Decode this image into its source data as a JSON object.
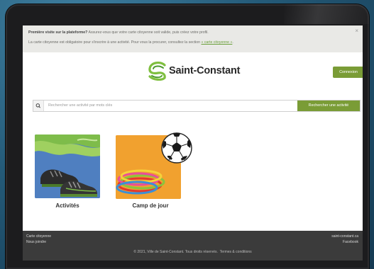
{
  "notice": {
    "line1_bold": "Première visite sur la plateforme?",
    "line1_text": " Assurez-vous que votre carte citoyenne soit valide, puis créez votre profil.",
    "line2_text": "La carte citoyenne est obligatoire pour s'inscrire à une activité. Pour vous la procurer, consultez la section ",
    "line2_link": "« carte citoyenne »",
    "line2_end": ".",
    "close": "×"
  },
  "header": {
    "logo_text": "Saint-Constant",
    "login_button": "Connexion"
  },
  "search": {
    "placeholder": "Rechercher une activité par mots clés",
    "button": "Rechercher une activité"
  },
  "cards": [
    {
      "label": "Activités"
    },
    {
      "label": "Camp de jour"
    }
  ],
  "footer": {
    "left_links": [
      "Carte citoyenne",
      "Nous joindre"
    ],
    "right_links": [
      "saint-constant.ca",
      "Facebook"
    ],
    "copyright": "© 2021, Ville de Saint-Constant. Tous droits réservés.",
    "terms": "Termes & conditions"
  },
  "colors": {
    "brand_green": "#7a9c36",
    "footer_bg": "#3b3b3b",
    "notice_bg": "#e9e9e6"
  }
}
